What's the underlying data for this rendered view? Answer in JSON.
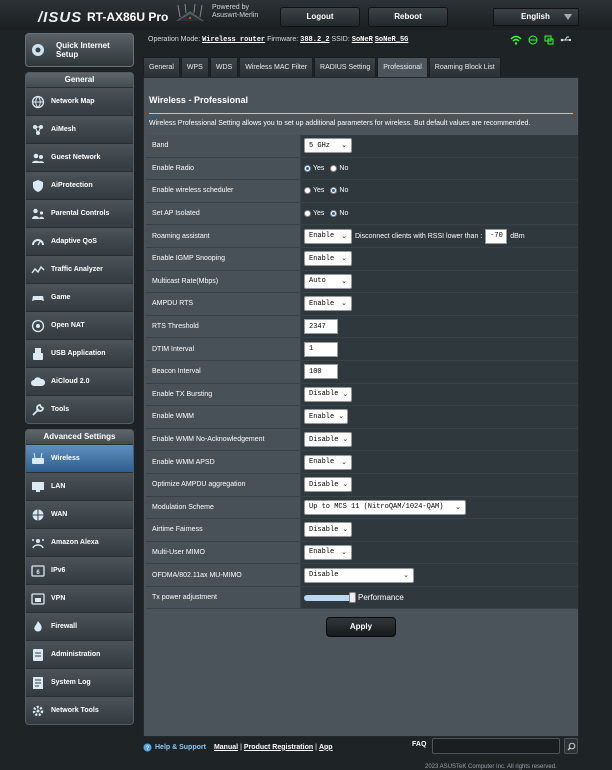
{
  "header": {
    "brand": "/ISUS",
    "model": "RT-AX86U Pro",
    "powered_by": "Powered by",
    "firmware_brand": "Asuswrt-Merlin",
    "logout": "Logout",
    "reboot": "Reboot",
    "language": "English"
  },
  "status": {
    "op_mode_label": "Operation Mode:",
    "op_mode": "Wireless router",
    "fw_label": "Firmware:",
    "fw": "388.2_2",
    "ssid_label": "SSID:",
    "ssid1": "SoNeR",
    "ssid2": "SoNeR_5G"
  },
  "sidebar": {
    "quick_setup": "Quick Internet Setup",
    "general_title": "General",
    "general": [
      {
        "label": "Network Map",
        "icon": "network-map-icon"
      },
      {
        "label": "AiMesh",
        "icon": "aimesh-icon"
      },
      {
        "label": "Guest Network",
        "icon": "guest-network-icon"
      },
      {
        "label": "AiProtection",
        "icon": "aiprotection-icon"
      },
      {
        "label": "Parental Controls",
        "icon": "parental-controls-icon"
      },
      {
        "label": "Adaptive QoS",
        "icon": "adaptive-qos-icon"
      },
      {
        "label": "Traffic Analyzer",
        "icon": "traffic-analyzer-icon"
      },
      {
        "label": "Game",
        "icon": "game-icon"
      },
      {
        "label": "Open NAT",
        "icon": "open-nat-icon"
      },
      {
        "label": "USB Application",
        "icon": "usb-icon"
      },
      {
        "label": "AiCloud 2.0",
        "icon": "aicloud-icon"
      },
      {
        "label": "Tools",
        "icon": "tools-icon"
      }
    ],
    "advanced_title": "Advanced Settings",
    "advanced": [
      {
        "label": "Wireless",
        "icon": "wireless-icon"
      },
      {
        "label": "LAN",
        "icon": "lan-icon"
      },
      {
        "label": "WAN",
        "icon": "wan-icon"
      },
      {
        "label": "Amazon Alexa",
        "icon": "alexa-icon"
      },
      {
        "label": "IPv6",
        "icon": "ipv6-icon"
      },
      {
        "label": "VPN",
        "icon": "vpn-icon"
      },
      {
        "label": "Firewall",
        "icon": "firewall-icon"
      },
      {
        "label": "Administration",
        "icon": "administration-icon"
      },
      {
        "label": "System Log",
        "icon": "system-log-icon"
      },
      {
        "label": "Network Tools",
        "icon": "network-tools-icon"
      }
    ]
  },
  "tabs": [
    "General",
    "WPS",
    "WDS",
    "Wireless MAC Filter",
    "RADIUS Setting",
    "Professional",
    "Roaming Block List"
  ],
  "active_tab": "Professional",
  "panel": {
    "title": "Wireless - Professional",
    "description": "Wireless Professional Setting allows you to set up additional parameters for wireless. But default values are recommended.",
    "rows": [
      {
        "label": "Band",
        "type": "select",
        "value": "5 GHz"
      },
      {
        "label": "Enable Radio",
        "type": "radio",
        "options": [
          "Yes",
          "No"
        ],
        "selected": "Yes"
      },
      {
        "label": "Enable wireless scheduler",
        "type": "radio",
        "options": [
          "Yes",
          "No"
        ],
        "selected": "No"
      },
      {
        "label": "Set AP Isolated",
        "type": "radio",
        "options": [
          "Yes",
          "No"
        ],
        "selected": "No"
      },
      {
        "label": "Roaming assistant",
        "type": "roaming",
        "value": "Enable",
        "text": "Disconnect clients with RSSI lower than :",
        "rssi": "-70",
        "unit": "dBm"
      },
      {
        "label": "Enable IGMP Snooping",
        "type": "select",
        "value": "Enable"
      },
      {
        "label": "Multicast Rate(Mbps)",
        "type": "select",
        "value": "Auto"
      },
      {
        "label": "AMPDU RTS",
        "type": "select",
        "value": "Enable"
      },
      {
        "label": "RTS Threshold",
        "type": "text",
        "value": "2347"
      },
      {
        "label": "DTIM Interval",
        "type": "text",
        "value": "1"
      },
      {
        "label": "Beacon Interval",
        "type": "text",
        "value": "100"
      },
      {
        "label": "Enable TX Bursting",
        "type": "select",
        "value": "Disable"
      },
      {
        "label": "Enable WMM",
        "type": "select",
        "value": "Enable"
      },
      {
        "label": "Enable WMM No-Acknowledgement",
        "type": "select",
        "value": "Disable"
      },
      {
        "label": "Enable WMM APSD",
        "type": "select",
        "value": "Enable"
      },
      {
        "label": "Optimize AMPDU aggregation",
        "type": "select",
        "value": "Disable"
      },
      {
        "label": "Modulation Scheme",
        "type": "select",
        "value": "Up to MCS 11 (NitroQAM/1024-QAM)"
      },
      {
        "label": "Airtime Fairness",
        "type": "select",
        "value": "Disable"
      },
      {
        "label": "Multi-User MIMO",
        "type": "select",
        "value": "Enable"
      },
      {
        "label": "OFDMA/802.11ax MU-MIMO",
        "type": "select",
        "value": "Disable"
      },
      {
        "label": "Tx power adjustment",
        "type": "slider",
        "value": 1.0,
        "text": "Performance"
      }
    ],
    "apply": "Apply"
  },
  "footer": {
    "help": "Help & Support",
    "manual": "Manual",
    "sep1": "|",
    "product_registration": "Product Registration",
    "sep2": "|",
    "app": "App",
    "faq": "FAQ",
    "copyright": "2023 ASUSTeK Computer Inc. All rights reserved."
  }
}
